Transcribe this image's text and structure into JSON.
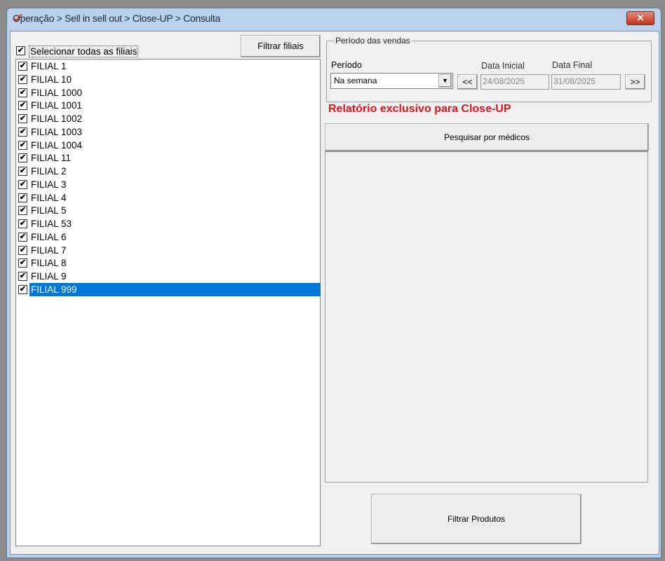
{
  "window": {
    "title": "Operação > Sell in sell out > Close-UP > Consulta",
    "logo": "✓",
    "close": "✕"
  },
  "left": {
    "select_all_label": "Selecionar todas as filiais",
    "select_all_checked": true,
    "filter_button": "Filtrar filiais",
    "items": [
      {
        "label": "FILIAL 1"
      },
      {
        "label": "FILIAL 10"
      },
      {
        "label": "FILIAL 1000"
      },
      {
        "label": "FILIAL 1001"
      },
      {
        "label": "FILIAL 1002"
      },
      {
        "label": "FILIAL 1003"
      },
      {
        "label": "FILIAL 1004"
      },
      {
        "label": "FILIAL 11"
      },
      {
        "label": "FILIAL 2"
      },
      {
        "label": "FILIAL 3"
      },
      {
        "label": "FILIAL 4"
      },
      {
        "label": "FILIAL 5"
      },
      {
        "label": "FILIAL 53"
      },
      {
        "label": "FILIAL 6"
      },
      {
        "label": "FILIAL 7"
      },
      {
        "label": "FILIAL 8"
      },
      {
        "label": "FILIAL 9"
      },
      {
        "label": "FILIAL 999",
        "selected": true
      }
    ]
  },
  "period": {
    "group_label": "Período das vendas",
    "period_label": "Período",
    "period_value": "Na semana",
    "prev": "<<",
    "next": ">>",
    "start_label": "Data Inicial",
    "start_value": "24/08/2025",
    "end_label": "Data Final",
    "end_value": "31/08/2025"
  },
  "notice": "Relatório exclusivo para Close-UP",
  "search_doctors_button": "Pesquisar por médicos",
  "filter_products_button": "Filtrar Produtos",
  "check": "✔"
}
